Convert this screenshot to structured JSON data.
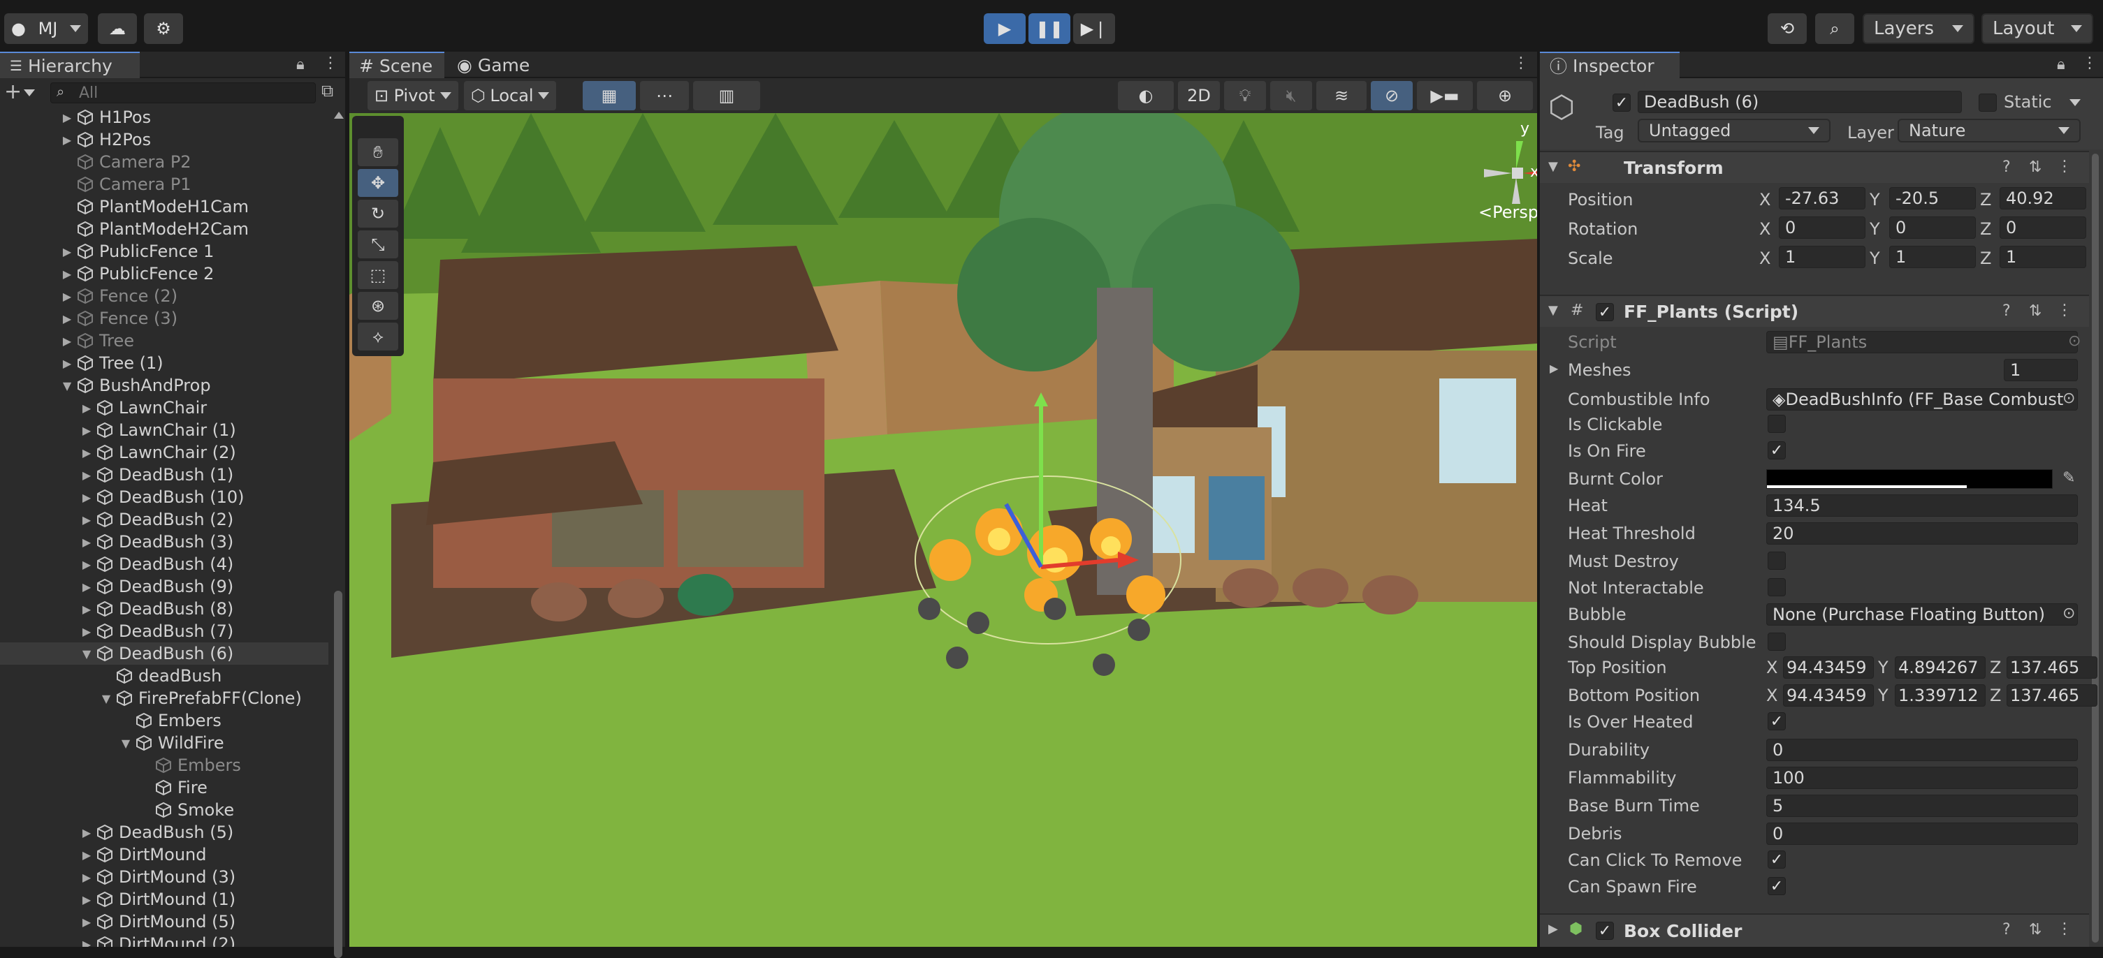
{
  "topbar": {
    "account": "MJ",
    "layers_label": "Layers",
    "layout_label": "Layout"
  },
  "hierarchy": {
    "tab": "Hierarchy",
    "search_placeholder": "All",
    "items": [
      {
        "label": "H1Pos",
        "indent": 1,
        "arrow": "▶",
        "dim": false
      },
      {
        "label": "H2Pos",
        "indent": 1,
        "arrow": "▶",
        "dim": false
      },
      {
        "label": "Camera P2",
        "indent": 1,
        "arrow": "",
        "dim": true
      },
      {
        "label": "Camera P1",
        "indent": 1,
        "arrow": "",
        "dim": true
      },
      {
        "label": "PlantModeH1Cam",
        "indent": 1,
        "arrow": "",
        "dim": false
      },
      {
        "label": "PlantModeH2Cam",
        "indent": 1,
        "arrow": "",
        "dim": false
      },
      {
        "label": "PublicFence 1",
        "indent": 1,
        "arrow": "▶",
        "dim": false
      },
      {
        "label": "PublicFence 2",
        "indent": 1,
        "arrow": "▶",
        "dim": false
      },
      {
        "label": "Fence (2)",
        "indent": 1,
        "arrow": "▶",
        "dim": true
      },
      {
        "label": "Fence (3)",
        "indent": 1,
        "arrow": "▶",
        "dim": true
      },
      {
        "label": "Tree",
        "indent": 1,
        "arrow": "▶",
        "dim": true
      },
      {
        "label": "Tree (1)",
        "indent": 1,
        "arrow": "▶",
        "dim": false
      },
      {
        "label": "BushAndProp",
        "indent": 1,
        "arrow": "▼",
        "dim": false
      },
      {
        "label": "LawnChair",
        "indent": 2,
        "arrow": "▶",
        "dim": false
      },
      {
        "label": "LawnChair (1)",
        "indent": 2,
        "arrow": "▶",
        "dim": false
      },
      {
        "label": "LawnChair (2)",
        "indent": 2,
        "arrow": "▶",
        "dim": false
      },
      {
        "label": "DeadBush (1)",
        "indent": 2,
        "arrow": "▶",
        "dim": false
      },
      {
        "label": "DeadBush (10)",
        "indent": 2,
        "arrow": "▶",
        "dim": false
      },
      {
        "label": "DeadBush (2)",
        "indent": 2,
        "arrow": "▶",
        "dim": false
      },
      {
        "label": "DeadBush (3)",
        "indent": 2,
        "arrow": "▶",
        "dim": false
      },
      {
        "label": "DeadBush (4)",
        "indent": 2,
        "arrow": "▶",
        "dim": false
      },
      {
        "label": "DeadBush (9)",
        "indent": 2,
        "arrow": "▶",
        "dim": false
      },
      {
        "label": "DeadBush (8)",
        "indent": 2,
        "arrow": "▶",
        "dim": false
      },
      {
        "label": "DeadBush (7)",
        "indent": 2,
        "arrow": "▶",
        "dim": false
      },
      {
        "label": "DeadBush (6)",
        "indent": 2,
        "arrow": "▼",
        "dim": false,
        "selected": true
      },
      {
        "label": "deadBush",
        "indent": 3,
        "arrow": "",
        "dim": false
      },
      {
        "label": "FirePrefabFF(Clone)",
        "indent": 3,
        "arrow": "▼",
        "dim": false
      },
      {
        "label": "Embers",
        "indent": 4,
        "arrow": "",
        "dim": false
      },
      {
        "label": "WildFire",
        "indent": 4,
        "arrow": "▼",
        "dim": false
      },
      {
        "label": "Embers",
        "indent": 5,
        "arrow": "",
        "dim": true
      },
      {
        "label": "Fire",
        "indent": 5,
        "arrow": "",
        "dim": false
      },
      {
        "label": "Smoke",
        "indent": 5,
        "arrow": "",
        "dim": false
      },
      {
        "label": "DeadBush (5)",
        "indent": 2,
        "arrow": "▶",
        "dim": false
      },
      {
        "label": "DirtMound",
        "indent": 2,
        "arrow": "▶",
        "dim": false
      },
      {
        "label": "DirtMound (3)",
        "indent": 2,
        "arrow": "▶",
        "dim": false
      },
      {
        "label": "DirtMound (1)",
        "indent": 2,
        "arrow": "▶",
        "dim": false
      },
      {
        "label": "DirtMound (5)",
        "indent": 2,
        "arrow": "▶",
        "dim": false
      },
      {
        "label": "DirtMound (2)",
        "indent": 2,
        "arrow": "▶",
        "dim": false
      }
    ]
  },
  "scene": {
    "tab_scene": "Scene",
    "tab_game": "Game",
    "pivot": "Pivot",
    "local": "Local",
    "mode_2d": "2D",
    "persp": "Persp",
    "axis_y": "y",
    "axis_x": "x"
  },
  "inspector": {
    "tab": "Inspector",
    "object_name": "DeadBush (6)",
    "static_label": "Static",
    "tag_label": "Tag",
    "tag_value": "Untagged",
    "layer_label": "Layer",
    "layer_value": "Nature",
    "transform": {
      "title": "Transform",
      "position_label": "Position",
      "rotation_label": "Rotation",
      "scale_label": "Scale",
      "position": {
        "x": "-27.63",
        "y": "-20.5",
        "z": "40.92"
      },
      "rotation": {
        "x": "0",
        "y": "0",
        "z": "0"
      },
      "scale": {
        "x": "1",
        "y": "1",
        "z": "1"
      }
    },
    "script": {
      "title": "FF_Plants (Script)",
      "script_label": "Script",
      "script_value": "FF_Plants",
      "meshes_label": "Meshes",
      "meshes_value": "1",
      "combustible_label": "Combustible Info",
      "combustible_value": "DeadBushInfo (FF_Base Combust",
      "is_clickable": "Is Clickable",
      "is_on_fire": "Is On Fire",
      "burnt_color": "Burnt Color",
      "heat_label": "Heat",
      "heat_value": "134.5",
      "heat_threshold_label": "Heat Threshold",
      "heat_threshold_value": "20",
      "must_destroy": "Must Destroy",
      "not_interactable": "Not Interactable",
      "bubble_label": "Bubble",
      "bubble_value": "None (Purchase Floating Button)",
      "should_display_bubble": "Should Display Bubble",
      "top_position_label": "Top Position",
      "top_position": {
        "x": "94.43459",
        "y": "4.894267",
        "z": "137.465"
      },
      "bottom_position_label": "Bottom Position",
      "bottom_position": {
        "x": "94.43459",
        "y": "1.339712",
        "z": "137.465"
      },
      "is_over_heated": "Is Over Heated",
      "durability_label": "Durability",
      "durability_value": "0",
      "flammability_label": "Flammability",
      "flammability_value": "100",
      "base_burn_time_label": "Base Burn Time",
      "base_burn_time_value": "5",
      "debris_label": "Debris",
      "debris_value": "0",
      "can_click_to_remove": "Can Click To Remove",
      "can_spawn_fire": "Can Spawn Fire"
    },
    "box_collider_title": "Box Collider",
    "axis": {
      "x": "X",
      "y": "Y",
      "z": "Z"
    }
  }
}
